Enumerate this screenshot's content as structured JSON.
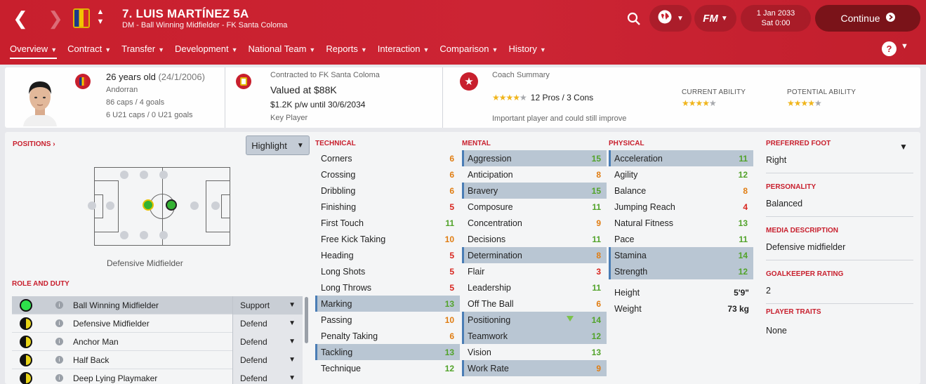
{
  "header": {
    "player_title": "7. LUIS MARTÍNEZ 5A",
    "subtitle": "DM - Ball Winning Midfielder - FK Santa Coloma",
    "date": "1 Jan 2033",
    "day_time": "Sat 0:00",
    "continue_label": "Continue",
    "fm_label": "FM"
  },
  "nav": [
    "Overview",
    "Contract",
    "Transfer",
    "Development",
    "National Team",
    "Reports",
    "Interaction",
    "Comparison",
    "History"
  ],
  "summary": {
    "age": "26 years old",
    "dob": "(24/1/2006)",
    "nationality": "Andorran",
    "caps": "86 caps / 4 goals",
    "u21": "6 U21 caps / 0 U21 goals",
    "contract_club": "Contracted to FK Santa Coloma",
    "value": "Valued at $88K",
    "wage": "$1.2K p/w until 30/6/2034",
    "status": "Key Player",
    "coach_title": "Coach Summary",
    "coach_stars": 4,
    "pros_cons": "12 Pros / 3 Cons",
    "coach_note": "Important player and could still improve",
    "ca_label": "CURRENT ABILITY",
    "pa_label": "POTENTIAL ABILITY",
    "ca_stars": 4,
    "pa_stars": 4
  },
  "positions": {
    "label": "POSITIONS",
    "highlight": "Highlight",
    "position_name": "Defensive Midfielder"
  },
  "roles": {
    "label": "ROLE AND DUTY",
    "items": [
      {
        "name": "Ball Winning Midfielder",
        "duty": "Support"
      },
      {
        "name": "Defensive Midfielder",
        "duty": "Defend"
      },
      {
        "name": "Anchor Man",
        "duty": "Defend"
      },
      {
        "name": "Half Back",
        "duty": "Defend"
      },
      {
        "name": "Deep Lying Playmaker",
        "duty": "Defend"
      }
    ]
  },
  "technical": {
    "label": "TECHNICAL",
    "attrs": [
      [
        "Corners",
        6
      ],
      [
        "Crossing",
        6
      ],
      [
        "Dribbling",
        6
      ],
      [
        "Finishing",
        5
      ],
      [
        "First Touch",
        11
      ],
      [
        "Free Kick Taking",
        10
      ],
      [
        "Heading",
        5
      ],
      [
        "Long Shots",
        5
      ],
      [
        "Long Throws",
        5
      ],
      [
        "Marking",
        13
      ],
      [
        "Passing",
        10
      ],
      [
        "Penalty Taking",
        6
      ],
      [
        "Tackling",
        13
      ],
      [
        "Technique",
        12
      ]
    ]
  },
  "mental": {
    "label": "MENTAL",
    "attrs": [
      [
        "Aggression",
        15
      ],
      [
        "Anticipation",
        8
      ],
      [
        "Bravery",
        15
      ],
      [
        "Composure",
        11
      ],
      [
        "Concentration",
        9
      ],
      [
        "Decisions",
        11
      ],
      [
        "Determination",
        8
      ],
      [
        "Flair",
        3
      ],
      [
        "Leadership",
        11
      ],
      [
        "Off The Ball",
        6
      ],
      [
        "Positioning",
        14
      ],
      [
        "Teamwork",
        12
      ],
      [
        "Vision",
        13
      ],
      [
        "Work Rate",
        9
      ]
    ]
  },
  "physical": {
    "label": "PHYSICAL",
    "attrs": [
      [
        "Acceleration",
        11
      ],
      [
        "Agility",
        12
      ],
      [
        "Balance",
        8
      ],
      [
        "Jumping Reach",
        4
      ],
      [
        "Natural Fitness",
        13
      ],
      [
        "Pace",
        11
      ],
      [
        "Stamina",
        14
      ],
      [
        "Strength",
        12
      ]
    ],
    "height_label": "Height",
    "height": "5'9\"",
    "weight_label": "Weight",
    "weight": "73 kg"
  },
  "right": {
    "pref_foot_label": "PREFERRED FOOT",
    "pref_foot": "Right",
    "personality_label": "PERSONALITY",
    "personality": "Balanced",
    "media_label": "MEDIA DESCRIPTION",
    "media": "Defensive midfielder",
    "gk_label": "GOALKEEPER RATING",
    "gk": "2",
    "traits_label": "PLAYER TRAITS",
    "traits": "None"
  },
  "colors": {
    "accent": "#c81f2d",
    "highlight_row": "#b9c6d3"
  }
}
